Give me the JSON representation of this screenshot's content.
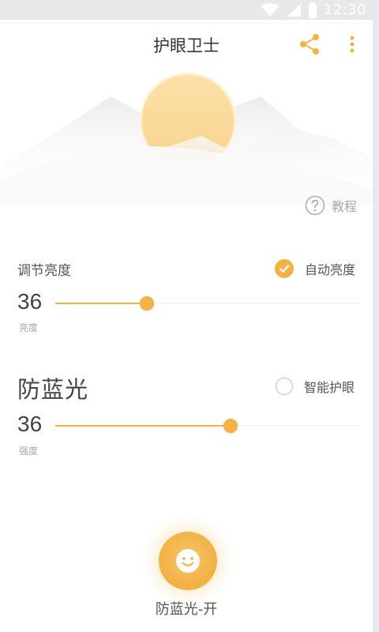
{
  "status_bar": {
    "time": "12:30"
  },
  "app_bar": {
    "title": "护眼卫士"
  },
  "tutorial": {
    "label": "教程"
  },
  "brightness": {
    "title": "调节亮度",
    "auto_label": "自动亮度",
    "auto_enabled": true,
    "value": "36",
    "unit": "亮度",
    "slider_fraction": 0.3
  },
  "blue_light": {
    "title": "防蓝光",
    "smart_label": "智能护眼",
    "smart_enabled": false,
    "value": "36",
    "unit": "强度",
    "slider_fraction": 0.575
  },
  "main_button": {
    "label": "防蓝光-开"
  },
  "colors": {
    "accent": "#f2b344",
    "text_primary": "#444444",
    "text_secondary": "#a8a8a8"
  }
}
